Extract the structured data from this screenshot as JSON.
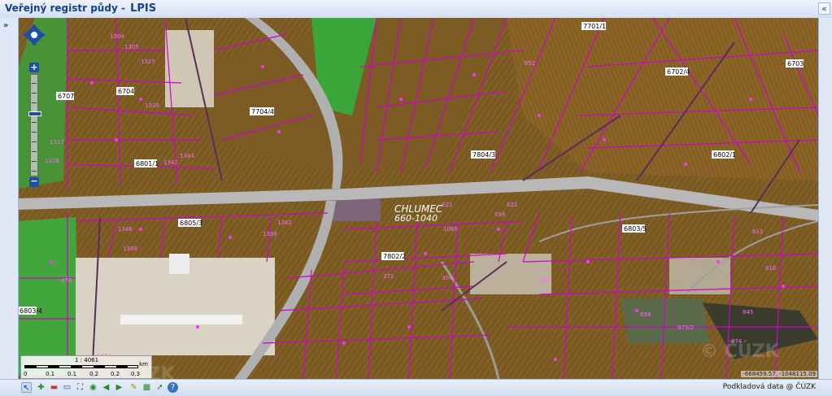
{
  "window": {
    "title": "Veřejný registr půdy -",
    "brand": "LPIS"
  },
  "panel_toggles": {
    "collapse": "«",
    "expand": "»"
  },
  "map": {
    "place_name": "CHLUMEC",
    "place_code": "660-1040",
    "block_labels": [
      "7701/1",
      "6703",
      "6702/4",
      "7704/4",
      "6707",
      "6704",
      "6801/1",
      "6802/1",
      "7804/3",
      "6805/3",
      "6803/5",
      "7802/2",
      "6803/4"
    ],
    "parcel_numbers": [
      "1304",
      "1305",
      "1327",
      "1330",
      "1342",
      "1344",
      "1317",
      "1316",
      "1348",
      "1389",
      "1388",
      "1382",
      "1373",
      "478",
      "652",
      "621",
      "599",
      "1085",
      "894",
      "973/2",
      "874",
      "845",
      "816",
      "611",
      "371",
      "304",
      "622",
      "706"
    ],
    "watermark": "© ČÚZK",
    "scale": {
      "ratio": "1 : 4061",
      "unit": "km",
      "ticks": [
        "0",
        "0.1",
        "0.1",
        "0.2",
        "0.2",
        "0.3"
      ]
    }
  },
  "statusbar": {
    "coordinates": "-668459.57, -1048115.09",
    "attribution": "Podkladová data @ ČÚZK"
  },
  "toolbar": {
    "tools": [
      "select-tool",
      "zoom-in-tool",
      "zoom-out-tool",
      "zoom-box-tool",
      "zoom-extent-tool",
      "full-extent-tool",
      "back-tool",
      "forward-tool",
      "measure-line-tool",
      "measure-area-tool",
      "identify-tool",
      "help-tool"
    ]
  },
  "colors": {
    "parcel_outline": "#d400d0",
    "arable": "#7a5a22",
    "grassland": "#3aa63a",
    "road": "#b8b8b8",
    "ui_accent": "#15428b"
  }
}
